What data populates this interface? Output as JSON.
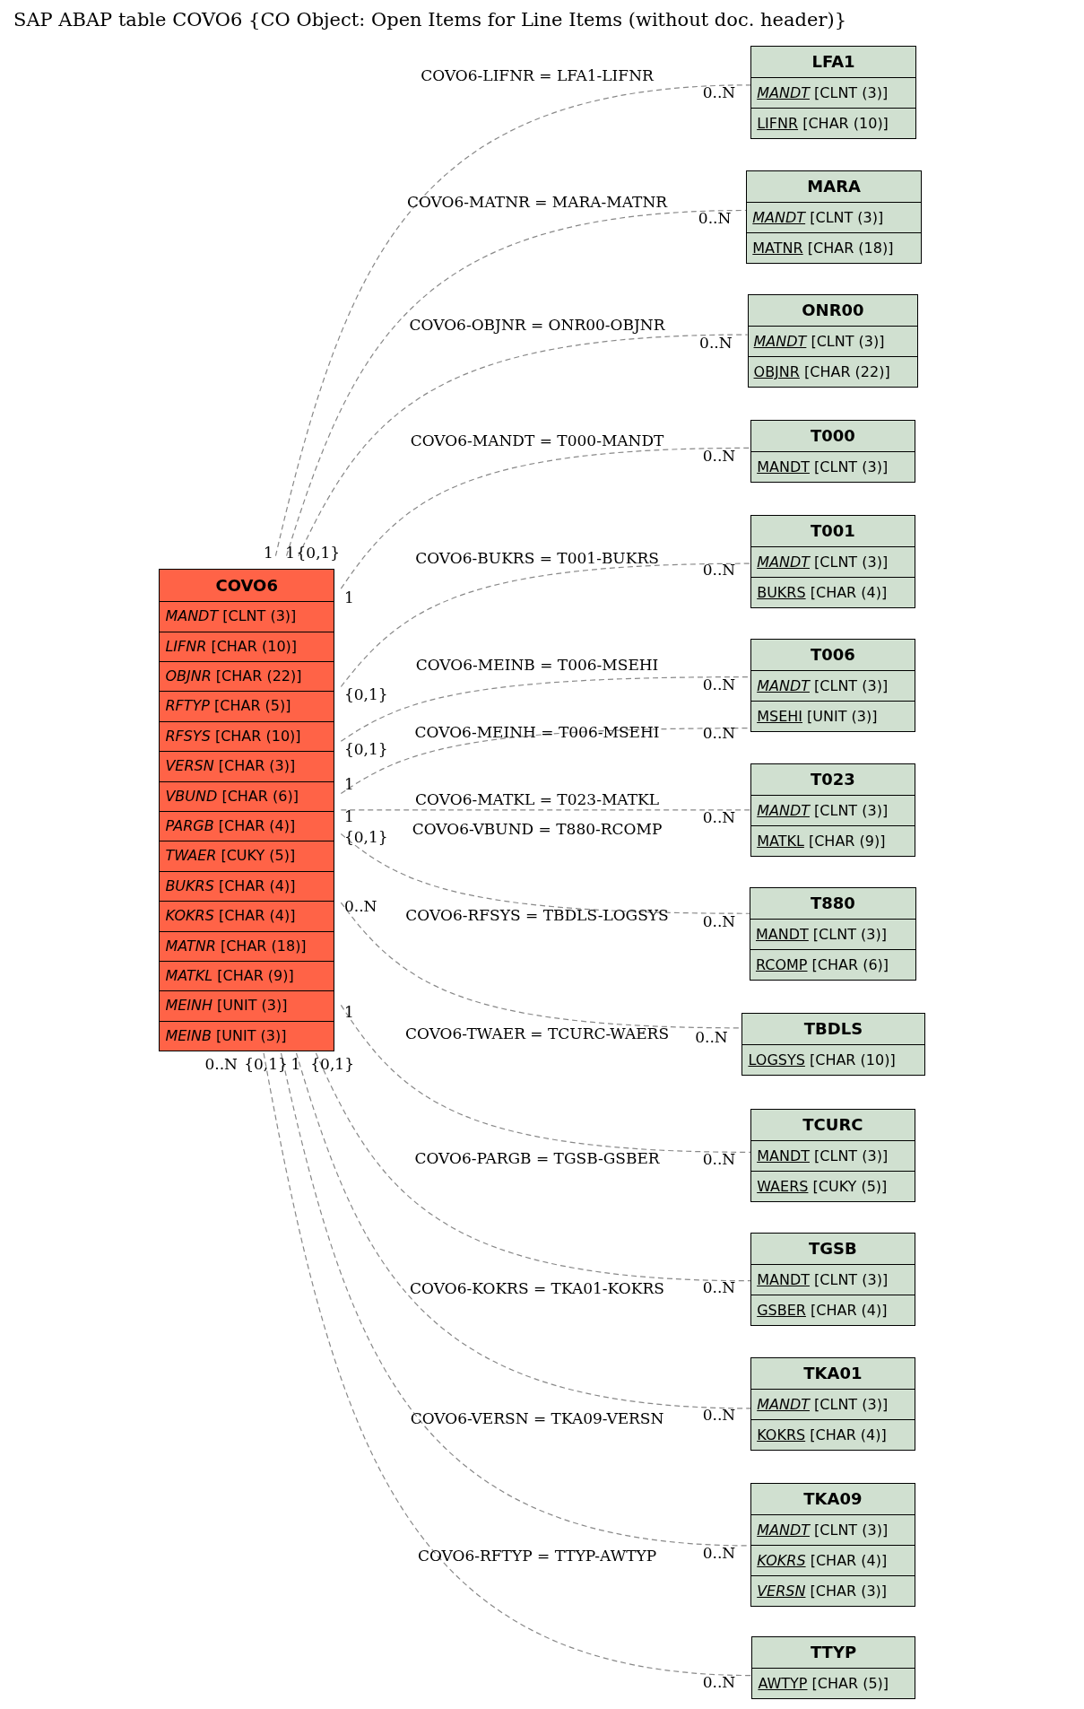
{
  "title": "SAP ABAP table COVO6 {CO Object: Open Items for Line Items (without doc. header)}",
  "main_table": {
    "name": "COVO6",
    "fields": [
      {
        "name": "MANDT",
        "type": "[CLNT (3)]",
        "key": false,
        "foreign": true
      },
      {
        "name": "LIFNR",
        "type": "[CHAR (10)]",
        "key": false,
        "foreign": true
      },
      {
        "name": "OBJNR",
        "type": "[CHAR (22)]",
        "key": false,
        "foreign": true
      },
      {
        "name": "RFTYP",
        "type": "[CHAR (5)]",
        "key": false,
        "foreign": true
      },
      {
        "name": "RFSYS",
        "type": "[CHAR (10)]",
        "key": false,
        "foreign": true
      },
      {
        "name": "VERSN",
        "type": "[CHAR (3)]",
        "key": false,
        "foreign": true
      },
      {
        "name": "VBUND",
        "type": "[CHAR (6)]",
        "key": false,
        "foreign": true
      },
      {
        "name": "PARGB",
        "type": "[CHAR (4)]",
        "key": false,
        "foreign": true
      },
      {
        "name": "TWAER",
        "type": "[CUKY (5)]",
        "key": false,
        "foreign": true
      },
      {
        "name": "BUKRS",
        "type": "[CHAR (4)]",
        "key": false,
        "foreign": true
      },
      {
        "name": "KOKRS",
        "type": "[CHAR (4)]",
        "key": false,
        "foreign": true
      },
      {
        "name": "MATNR",
        "type": "[CHAR (18)]",
        "key": false,
        "foreign": true
      },
      {
        "name": "MATKL",
        "type": "[CHAR (9)]",
        "key": false,
        "foreign": true
      },
      {
        "name": "MEINH",
        "type": "[UNIT (3)]",
        "key": false,
        "foreign": true
      },
      {
        "name": "MEINB",
        "type": "[UNIT (3)]",
        "key": false,
        "foreign": true
      }
    ]
  },
  "tables": [
    {
      "name": "LFA1",
      "fields": [
        {
          "name": "MANDT",
          "type": "[CLNT (3)]",
          "key": true,
          "foreign": true
        },
        {
          "name": "LIFNR",
          "type": "[CHAR (10)]",
          "key": true,
          "foreign": false
        }
      ]
    },
    {
      "name": "MARA",
      "fields": [
        {
          "name": "MANDT",
          "type": "[CLNT (3)]",
          "key": true,
          "foreign": true
        },
        {
          "name": "MATNR",
          "type": "[CHAR (18)]",
          "key": true,
          "foreign": false
        }
      ]
    },
    {
      "name": "ONR00",
      "fields": [
        {
          "name": "MANDT",
          "type": "[CLNT (3)]",
          "key": true,
          "foreign": true
        },
        {
          "name": "OBJNR",
          "type": "[CHAR (22)]",
          "key": true,
          "foreign": false
        }
      ]
    },
    {
      "name": "T000",
      "fields": [
        {
          "name": "MANDT",
          "type": "[CLNT (3)]",
          "key": true,
          "foreign": false
        }
      ]
    },
    {
      "name": "T001",
      "fields": [
        {
          "name": "MANDT",
          "type": "[CLNT (3)]",
          "key": true,
          "foreign": true
        },
        {
          "name": "BUKRS",
          "type": "[CHAR (4)]",
          "key": true,
          "foreign": false
        }
      ]
    },
    {
      "name": "T006",
      "fields": [
        {
          "name": "MANDT",
          "type": "[CLNT (3)]",
          "key": true,
          "foreign": true
        },
        {
          "name": "MSEHI",
          "type": "[UNIT (3)]",
          "key": true,
          "foreign": false
        }
      ]
    },
    {
      "name": "T023",
      "fields": [
        {
          "name": "MANDT",
          "type": "[CLNT (3)]",
          "key": true,
          "foreign": true
        },
        {
          "name": "MATKL",
          "type": "[CHAR (9)]",
          "key": true,
          "foreign": false
        }
      ]
    },
    {
      "name": "T880",
      "fields": [
        {
          "name": "MANDT",
          "type": "[CLNT (3)]",
          "key": true,
          "foreign": false
        },
        {
          "name": "RCOMP",
          "type": "[CHAR (6)]",
          "key": true,
          "foreign": false
        }
      ]
    },
    {
      "name": "TBDLS",
      "fields": [
        {
          "name": "LOGSYS",
          "type": "[CHAR (10)]",
          "key": true,
          "foreign": false
        }
      ]
    },
    {
      "name": "TCURC",
      "fields": [
        {
          "name": "MANDT",
          "type": "[CLNT (3)]",
          "key": true,
          "foreign": false
        },
        {
          "name": "WAERS",
          "type": "[CUKY (5)]",
          "key": true,
          "foreign": false
        }
      ]
    },
    {
      "name": "TGSB",
      "fields": [
        {
          "name": "MANDT",
          "type": "[CLNT (3)]",
          "key": true,
          "foreign": false
        },
        {
          "name": "GSBER",
          "type": "[CHAR (4)]",
          "key": true,
          "foreign": false
        }
      ]
    },
    {
      "name": "TKA01",
      "fields": [
        {
          "name": "MANDT",
          "type": "[CLNT (3)]",
          "key": true,
          "foreign": true
        },
        {
          "name": "KOKRS",
          "type": "[CHAR (4)]",
          "key": true,
          "foreign": false
        }
      ]
    },
    {
      "name": "TKA09",
      "fields": [
        {
          "name": "MANDT",
          "type": "[CLNT (3)]",
          "key": true,
          "foreign": true
        },
        {
          "name": "KOKRS",
          "type": "[CHAR (4)]",
          "key": true,
          "foreign": true
        },
        {
          "name": "VERSN",
          "type": "[CHAR (3)]",
          "key": true,
          "foreign": true
        }
      ]
    },
    {
      "name": "TTYP",
      "fields": [
        {
          "name": "AWTYP",
          "type": "[CHAR (5)]",
          "key": true,
          "foreign": false
        }
      ]
    }
  ],
  "near_cardinalities": [
    "1",
    "1",
    "{0,1}",
    "1",
    "{0,1}",
    "{0,1}",
    "1",
    "1",
    "{0,1}",
    "0..N",
    "1",
    "0..N",
    "{0,1}",
    "1",
    "{0,1}"
  ],
  "relations": [
    {
      "label": "COVO6-LIFNR = LFA1-LIFNR",
      "far": "0..N"
    },
    {
      "label": "COVO6-MATNR = MARA-MATNR",
      "far": "0..N"
    },
    {
      "label": "COVO6-OBJNR = ONR00-OBJNR",
      "far": "0..N"
    },
    {
      "label": "COVO6-MANDT = T000-MANDT",
      "far": "0..N"
    },
    {
      "label": "COVO6-BUKRS = T001-BUKRS",
      "far": "0..N"
    },
    {
      "label": "COVO6-MEINB = T006-MSEHI",
      "far": "0..N"
    },
    {
      "label": "COVO6-MEINH = T006-MSEHI",
      "far": "0..N"
    },
    {
      "label": "COVO6-MATKL = T023-MATKL",
      "far": "0..N"
    },
    {
      "label": "COVO6-VBUND = T880-RCOMP",
      "far": "0..N"
    },
    {
      "label": "COVO6-RFSYS = TBDLS-LOGSYS",
      "far": "0..N"
    },
    {
      "label": "COVO6-TWAER = TCURC-WAERS",
      "far": "0..N"
    },
    {
      "label": "COVO6-PARGB = TGSB-GSBER",
      "far": "0..N"
    },
    {
      "label": "COVO6-KOKRS = TKA01-KOKRS",
      "far": "0..N"
    },
    {
      "label": "COVO6-VERSN = TKA09-VERSN",
      "far": "0..N"
    },
    {
      "label": "COVO6-RFTYP = TTYP-AWTYP",
      "far": "0..N"
    }
  ]
}
